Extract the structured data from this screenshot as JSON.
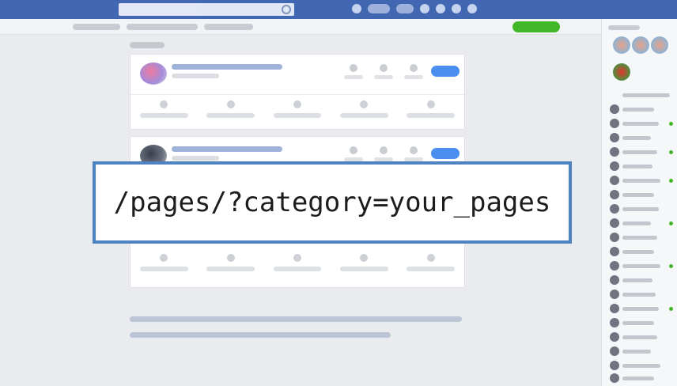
{
  "overlay": {
    "url_text": "/pages/?category=your_pages"
  },
  "colors": {
    "topbar": "#4267b2",
    "background": "#e9ebee",
    "overlay_border": "#4f82c0",
    "primary_button": "#4a8ef0",
    "create_button": "#42b72a"
  },
  "icons": {
    "search": "search-icon",
    "story": "avatar",
    "contact": "avatar"
  }
}
